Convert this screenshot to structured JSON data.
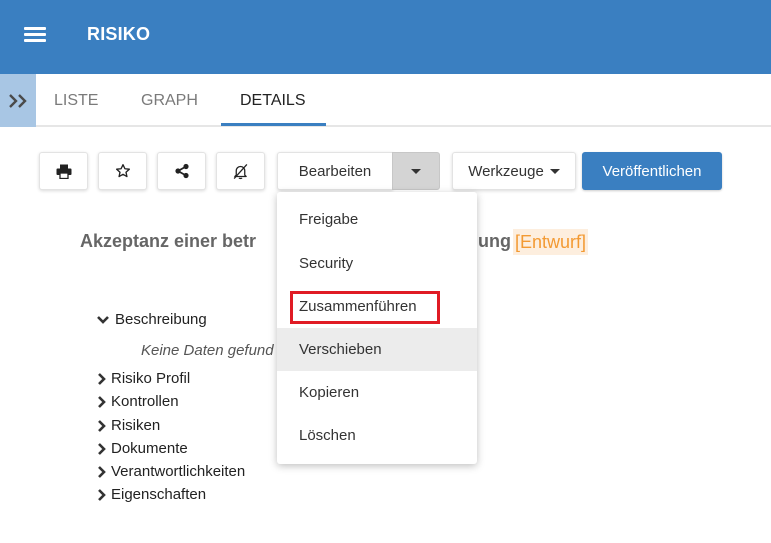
{
  "header": {
    "title": "RISIKO"
  },
  "tabs": [
    {
      "label": "LISTE"
    },
    {
      "label": "GRAPH"
    },
    {
      "label": "DETAILS"
    }
  ],
  "toolbar": {
    "edit_label": "Bearbeiten",
    "tools_label": "Werkzeuge",
    "publish_label": "Veröffentlichen"
  },
  "document": {
    "title_start": "Akzeptanz einer betr",
    "title_end": "ung",
    "status": "[Entwurf]"
  },
  "tree": {
    "items": [
      {
        "label": "Beschreibung"
      },
      {
        "label": "Risiko Profil"
      },
      {
        "label": "Kontrollen"
      },
      {
        "label": "Risiken"
      },
      {
        "label": "Dokumente"
      },
      {
        "label": "Verantwortlichkeiten"
      },
      {
        "label": "Eigenschaften"
      }
    ],
    "empty_text": "Keine Daten gefund"
  },
  "dropdown": {
    "items": [
      {
        "label": "Freigabe"
      },
      {
        "label": "Security"
      },
      {
        "label": "Zusammenführen"
      },
      {
        "label": "Verschieben"
      },
      {
        "label": "Kopieren"
      },
      {
        "label": "Löschen"
      }
    ]
  },
  "colors": {
    "primary": "#3a7fc1",
    "draft": "#f39a33",
    "highlight": "#e01b24"
  }
}
